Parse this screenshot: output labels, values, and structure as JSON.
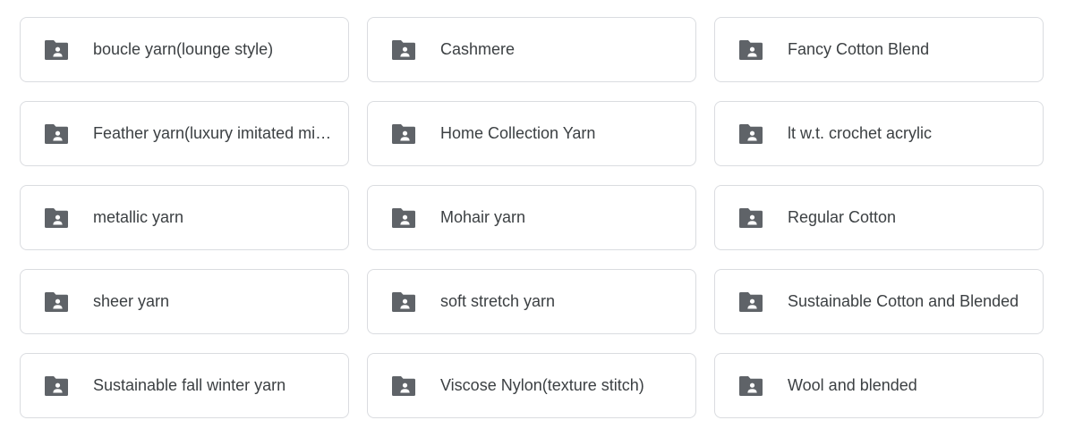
{
  "folders": [
    {
      "label": "boucle yarn(lounge style)",
      "icon": "shared-folder-icon"
    },
    {
      "label": "Cashmere",
      "icon": "shared-folder-icon"
    },
    {
      "label": "Fancy Cotton Blend",
      "icon": "shared-folder-icon"
    },
    {
      "label": "Feather yarn(luxury imitated mink)",
      "icon": "shared-folder-icon"
    },
    {
      "label": "Home Collection Yarn",
      "icon": "shared-folder-icon"
    },
    {
      "label": "lt w.t. crochet acrylic",
      "icon": "shared-folder-icon"
    },
    {
      "label": "metallic yarn",
      "icon": "shared-folder-icon"
    },
    {
      "label": "Mohair yarn",
      "icon": "shared-folder-icon"
    },
    {
      "label": "Regular Cotton",
      "icon": "shared-folder-icon"
    },
    {
      "label": "sheer yarn",
      "icon": "shared-folder-icon"
    },
    {
      "label": "soft stretch yarn",
      "icon": "shared-folder-icon"
    },
    {
      "label": "Sustainable Cotton and Blended",
      "icon": "shared-folder-icon"
    },
    {
      "label": "Sustainable fall winter yarn",
      "icon": "shared-folder-icon"
    },
    {
      "label": "Viscose Nylon(texture stitch)",
      "icon": "shared-folder-icon"
    },
    {
      "label": "Wool and blended",
      "icon": "shared-folder-icon"
    }
  ],
  "colors": {
    "icon": "#5f6368",
    "text": "#3c4043",
    "border": "#dadce0"
  }
}
